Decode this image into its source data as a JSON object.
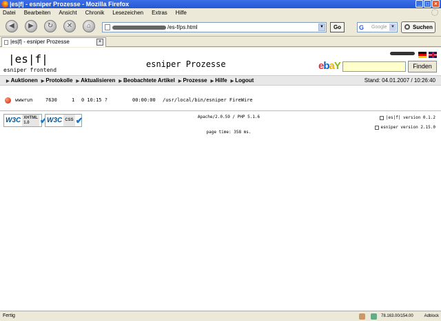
{
  "window": {
    "title": "|es|f| - esniper Prozesse - Mozilla Firefox"
  },
  "menu": [
    "Datei",
    "Bearbeiten",
    "Ansicht",
    "Chronik",
    "Lesezeichen",
    "Extras",
    "Hilfe"
  ],
  "toolbar": {
    "url_suffix": "/es-f/ps.html",
    "go_label": "Go",
    "search_placeholder": "Google",
    "search_button": "Suchen"
  },
  "tab": {
    "label": "|es|f| - esniper Prozesse"
  },
  "page": {
    "logo": "|es|f|",
    "logo_sub": "esniper frontend",
    "title": "esniper Prozesse",
    "finden_label": "Finden",
    "nav": [
      "Auktionen",
      "Protokolle",
      "Aktualisieren",
      "Beobachtete Artikel",
      "Prozesse",
      "Hilfe",
      "Logout"
    ],
    "stand": "Stand: 04.01.2007 / 10:26:40",
    "process": {
      "user": "wwwrun",
      "pid": "7630",
      "c1": "1",
      "c2": "0 10:15 ?",
      "time": "00:00:00",
      "cmd": "/usr/local/bin/esniper FireWire"
    },
    "server_info": "Apache/2.0.59 / PHP 5.1.6",
    "page_time": "page time: 358 ms.",
    "version_esf": "|es|f| version 0.1.2",
    "version_esniper": "esniper version 2.15.0",
    "badges": {
      "xhtml_w3": "W3C",
      "xhtml_label1": "XHTML",
      "xhtml_label2": "1.0",
      "css_w3": "W3C",
      "css_label": "CSS"
    }
  },
  "statusbar": {
    "text": "Fertig",
    "ip": "78.163.00/154.00",
    "adblock": "Adblock"
  }
}
